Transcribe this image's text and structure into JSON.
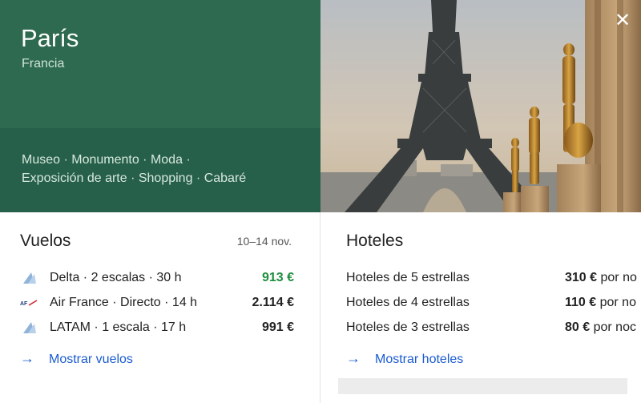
{
  "destination": {
    "city": "París",
    "country": "Francia",
    "tags_line1": "Museo · Monumento · Moda ·",
    "tags_line2": "Exposición de arte · Shopping · Cabaré"
  },
  "close_icon": "close-icon",
  "flights": {
    "title": "Vuelos",
    "dates": "10–14 nov.",
    "items": [
      {
        "logo": "delta-logo-icon",
        "text": "Delta · 2 escalas · 30 h",
        "price": "913 €",
        "price_color": "#1e8e3e"
      },
      {
        "logo": "air-france-logo-icon",
        "text": "Air France · Directo · 14 h",
        "price": "2.114 €",
        "price_color": "#222222"
      },
      {
        "logo": "latam-logo-icon",
        "text": "LATAM · 1 escala · 17 h",
        "price": "991 €",
        "price_color": "#222222"
      }
    ],
    "more_link": "Mostrar vuelos"
  },
  "hotels": {
    "title": "Hoteles",
    "items": [
      {
        "text": "Hoteles de 5 estrellas",
        "price": "310 €",
        "suffix": "por no"
      },
      {
        "text": "Hoteles de 4 estrellas",
        "price": "110 €",
        "suffix": "por no"
      },
      {
        "text": "Hoteles de 3 estrellas",
        "price": "80 €",
        "suffix": "por noc"
      }
    ],
    "more_link": "Mostrar hoteles"
  },
  "colors": {
    "hero_green": "#2e6a4f",
    "link_blue": "#1a5bd0",
    "price_green": "#1e8e3e"
  }
}
